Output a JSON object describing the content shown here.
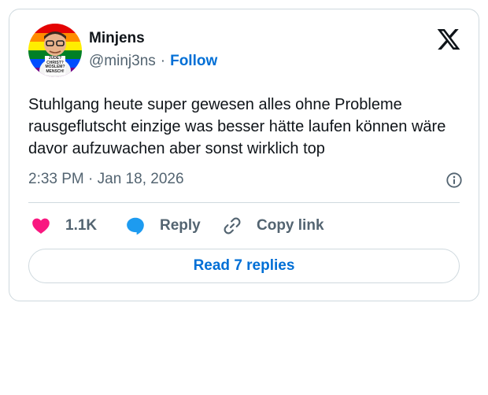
{
  "author": {
    "name": "Minjens",
    "handle": "@minj3ns",
    "separator": "·",
    "follow_label": "Follow",
    "avatar_shirt_text": [
      "JUDE?",
      "CHRIST?",
      "MOSLEM?",
      "MENSCH!"
    ]
  },
  "tweet": {
    "text": "Stuhlgang heute super gewesen alles ohne Probleme rausgeflutscht einzige was besser hätte laufen können wäre davor aufzuwachen aber sonst wirklich top",
    "timestamp": "2:33 PM · Jan 18, 2026"
  },
  "actions": {
    "like_count": "1.1K",
    "reply_label": "Reply",
    "copy_label": "Copy link"
  },
  "read_replies_label": "Read 7 replies",
  "icons": {
    "logo": "x-logo-icon",
    "info": "info-icon",
    "like": "heart-icon",
    "reply": "reply-bubble-icon",
    "copy": "link-icon"
  },
  "colors": {
    "like": "#f91880",
    "reply": "#1d9bf0",
    "link": "#006fd6",
    "muted": "#536471",
    "border": "#cfd9de"
  }
}
